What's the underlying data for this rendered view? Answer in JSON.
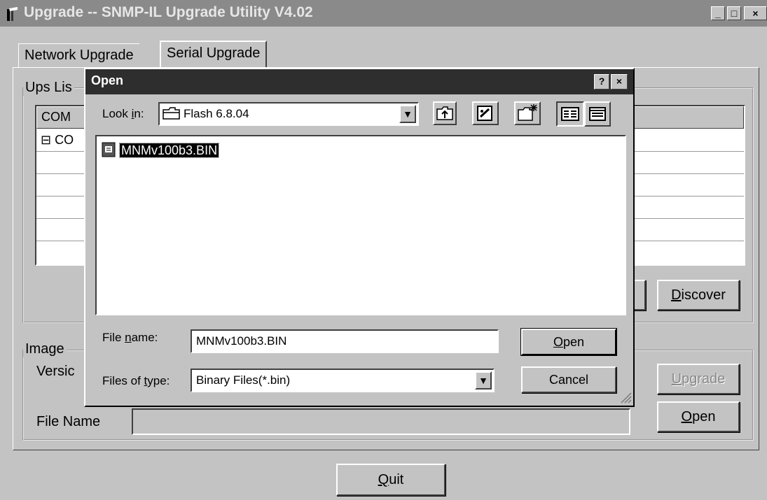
{
  "window": {
    "title": "Upgrade --  SNMP-IL Upgrade Utility V4.02",
    "minimize_glyph": "_",
    "maximize_glyph": "□",
    "close_glyph": "×"
  },
  "tabs": [
    {
      "label": "Network Upgrade"
    },
    {
      "label": "Serial Upgrade"
    }
  ],
  "ups_list": {
    "group_label": "Ups Lis",
    "column_header": "COM",
    "row_text": "CO",
    "discover_prefix": "D",
    "discover_rest": "iscover"
  },
  "image_group": {
    "group_label": "Image",
    "version_label": "Versic",
    "file_name_label": "File Name",
    "upgrade_prefix": "U",
    "upgrade_rest": "pgrade",
    "open_prefix": "O",
    "open_rest": "pen"
  },
  "quit": {
    "prefix": "Q",
    "rest": "uit"
  },
  "dialog": {
    "title": "Open",
    "help_glyph": "?",
    "close_glyph": "×",
    "look_in_pre": "Look ",
    "look_in_u": "i",
    "look_in_post": "n:",
    "look_in_value": "Flash 6.8.04",
    "files": [
      "MNMv100b3.BIN"
    ],
    "file_name_pre": "File ",
    "file_name_u": "n",
    "file_name_post": "ame:",
    "file_name_value": "MNMv100b3.BIN",
    "files_of_type_pre": "Files of ",
    "files_of_type_u": "t",
    "files_of_type_post": "ype:",
    "files_of_type_value": "Binary Files(*.bin)",
    "open_prefix": "O",
    "open_rest": "pen",
    "cancel_label": "Cancel",
    "dropdown_glyph": "▼",
    "icons": [
      "folder-icon",
      "up-folder-icon",
      "desktop-icon",
      "new-folder-icon",
      "list-view-icon",
      "details-view-icon",
      "file-icon",
      "size-grip-icon"
    ]
  }
}
